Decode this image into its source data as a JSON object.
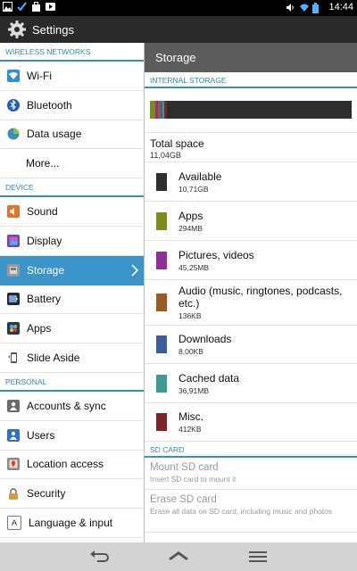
{
  "status": {
    "time": "14:44"
  },
  "app": {
    "title": "Settings"
  },
  "nav": {
    "sections": [
      {
        "header": "WIRELESS NETWORKS",
        "items": [
          {
            "label": "Wi-Fi",
            "icon": "wifi-icon"
          },
          {
            "label": "Bluetooth",
            "icon": "bluetooth-icon"
          },
          {
            "label": "Data usage",
            "icon": "data-usage-icon"
          },
          {
            "label": "More...",
            "icon": null
          }
        ]
      },
      {
        "header": "DEVICE",
        "items": [
          {
            "label": "Sound",
            "icon": "sound-icon"
          },
          {
            "label": "Display",
            "icon": "display-icon"
          },
          {
            "label": "Storage",
            "icon": "storage-icon",
            "active": true
          },
          {
            "label": "Battery",
            "icon": "battery-icon"
          },
          {
            "label": "Apps",
            "icon": "apps-icon"
          },
          {
            "label": "Slide Aside",
            "icon": "slide-aside-icon"
          }
        ]
      },
      {
        "header": "PERSONAL",
        "items": [
          {
            "label": "Accounts & sync",
            "icon": "accounts-icon"
          },
          {
            "label": "Users",
            "icon": "users-icon"
          },
          {
            "label": "Location access",
            "icon": "location-icon"
          },
          {
            "label": "Security",
            "icon": "lock-icon"
          },
          {
            "label": "Language & input",
            "icon": "language-icon"
          }
        ]
      }
    ]
  },
  "storage": {
    "title": "Storage",
    "internal_header": "INTERNAL STORAGE",
    "total_label": "Total space",
    "total_value": "11,04GB",
    "categories": [
      {
        "name": "Available",
        "size": "10,71GB",
        "color": "#2d2d2d"
      },
      {
        "name": "Apps",
        "size": "294MB",
        "color": "#7d8b1a"
      },
      {
        "name": "Pictures, videos",
        "size": "45,25MB",
        "color": "#8e2e96"
      },
      {
        "name": "Audio (music, ringtones, podcasts, etc.)",
        "size": "136KB",
        "color": "#9c5a23"
      },
      {
        "name": "Downloads",
        "size": "8,00KB",
        "color": "#3d5e9c"
      },
      {
        "name": "Cached data",
        "size": "36,91MB",
        "color": "#3a9c92"
      },
      {
        "name": "Misc.",
        "size": "412KB",
        "color": "#7e2326"
      }
    ],
    "bar_segments": [
      {
        "color": "#7d8b1a",
        "fraction": 0.027
      },
      {
        "color": "#8e2e96",
        "fraction": 0.012
      },
      {
        "color": "#9c5a23",
        "fraction": 0.012
      },
      {
        "color": "#3d5e9c",
        "fraction": 0.01
      },
      {
        "color": "#3a9c92",
        "fraction": 0.012
      },
      {
        "color": "#7e2326",
        "fraction": 0.01
      }
    ],
    "sd_header": "SD CARD",
    "sd_items": [
      {
        "name": "Mount SD card",
        "desc": "Insert SD card to mount it"
      },
      {
        "name": "Erase SD card",
        "desc": "Erase all data on SD card, including music and photos"
      }
    ]
  }
}
